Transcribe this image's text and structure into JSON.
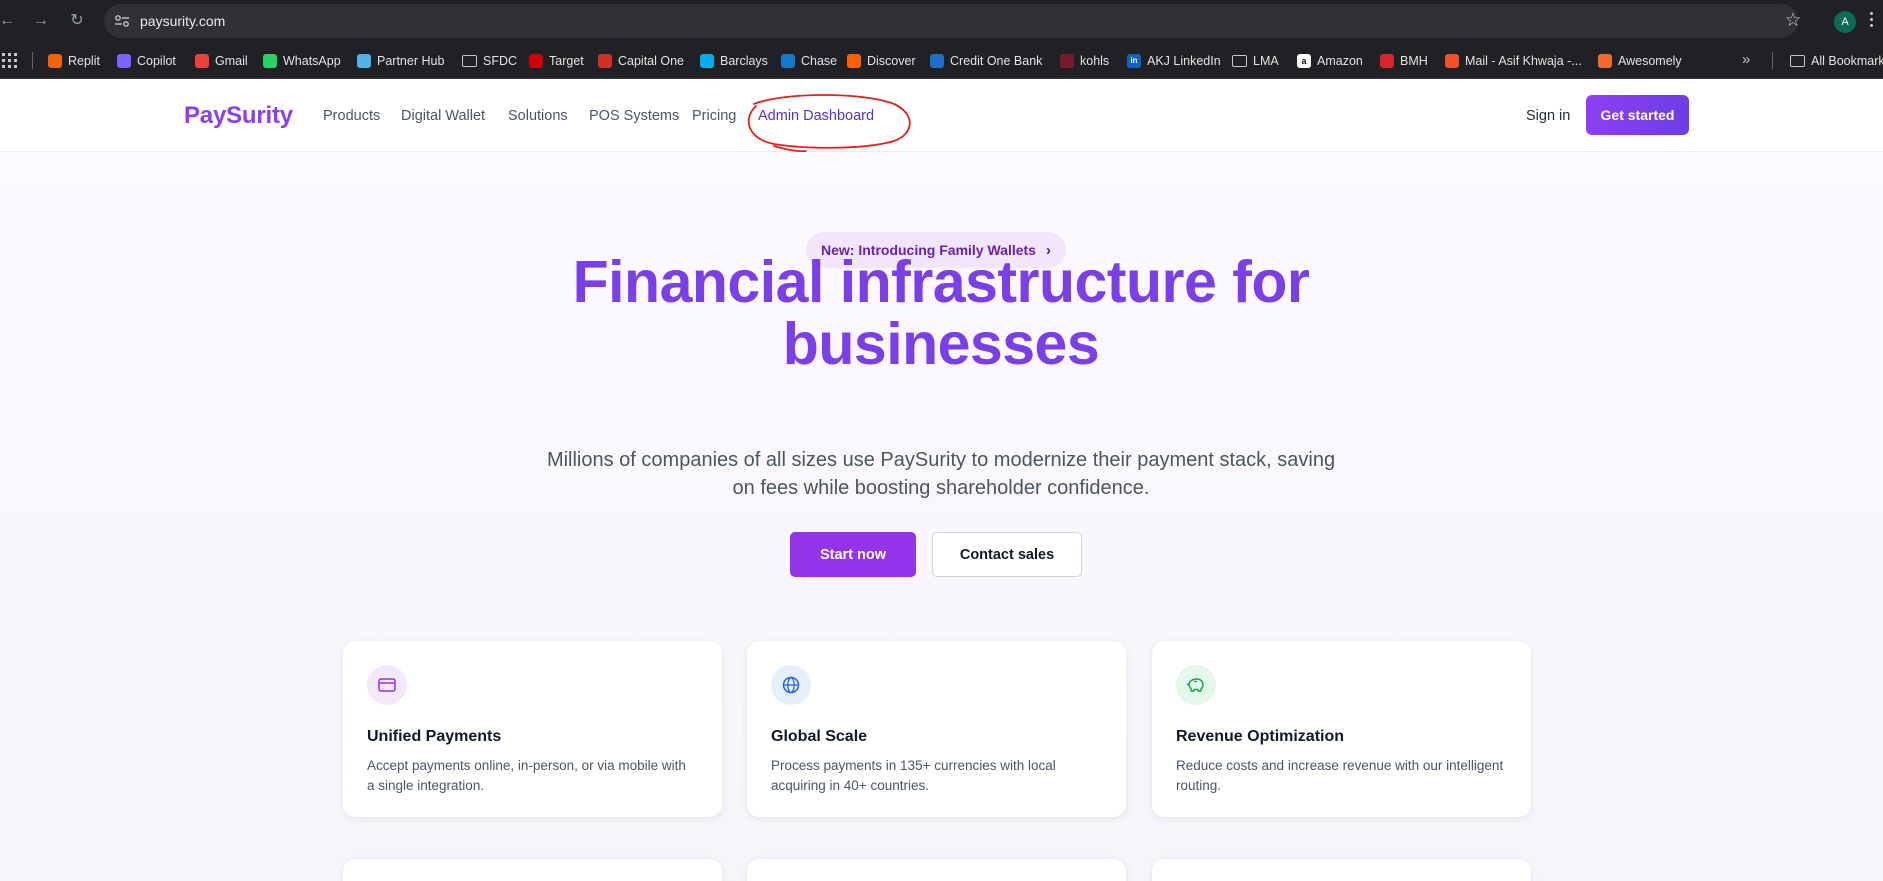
{
  "browser": {
    "url": "paysurity.com",
    "profile_initial": "A",
    "bookmarks": [
      {
        "label": "Replit",
        "icon": "replit-icon",
        "color": "#f26207"
      },
      {
        "label": "Copilot",
        "icon": "copilot-icon",
        "color": "#7b61ff"
      },
      {
        "label": "Gmail",
        "icon": "gmail-icon",
        "color": "#ea4335"
      },
      {
        "label": "WhatsApp",
        "icon": "whatsapp-icon",
        "color": "#25d366"
      },
      {
        "label": "Partner Hub",
        "icon": "partner-hub-icon",
        "color": "#4fb3e8"
      },
      {
        "label": "SFDC",
        "icon": "folder-icon",
        "color": "#c4c7c5"
      },
      {
        "label": "Target",
        "icon": "target-icon",
        "color": "#cc0000"
      },
      {
        "label": "Capital One",
        "icon": "capital-one-icon",
        "color": "#d03027"
      },
      {
        "label": "Barclays",
        "icon": "barclays-icon",
        "color": "#00aeef"
      },
      {
        "label": "Chase",
        "icon": "chase-icon",
        "color": "#117aca"
      },
      {
        "label": "Discover",
        "icon": "discover-icon",
        "color": "#ff6000"
      },
      {
        "label": "Credit One Bank",
        "icon": "credit-one-icon",
        "color": "#1a6fc9"
      },
      {
        "label": "kohls",
        "icon": "kohls-icon",
        "color": "#7a1a2c"
      },
      {
        "label": "AKJ LinkedIn",
        "icon": "linkedin-icon",
        "color": "#0a66c2"
      },
      {
        "label": "LMA",
        "icon": "folder-icon",
        "color": "#c4c7c5"
      },
      {
        "label": "Amazon",
        "icon": "amazon-icon",
        "color": "#ffffff"
      },
      {
        "label": "BMH",
        "icon": "bmh-icon",
        "color": "#d6262b"
      },
      {
        "label": "Mail - Asif Khwaja -...",
        "icon": "microsoft-icon",
        "color": "#f25022"
      },
      {
        "label": "Awesomely",
        "icon": "awesomely-icon",
        "color": "#f26a2e"
      }
    ],
    "all_bookmarks_label": "All Bookmarks"
  },
  "site": {
    "logo": "PaySurity",
    "nav": [
      "Products",
      "Digital Wallet",
      "Solutions",
      "POS Systems",
      "Pricing",
      "Admin Dashboard"
    ],
    "active_nav": "Admin Dashboard",
    "sign_in": "Sign in",
    "get_started": "Get started",
    "colors": {
      "brand": "#8b3ff0",
      "primary_button": "#9333ea",
      "annotation": "#e02020"
    }
  },
  "hero": {
    "pill": "New: Introducing Family Wallets",
    "title_line1": "Financial infrastructure for",
    "title_line2": "businesses",
    "subtitle": "Millions of companies of all sizes use PaySurity to modernize their payment stack, saving on fees while boosting shareholder confidence.",
    "start_now": "Start now",
    "contact_sales": "Contact sales"
  },
  "features": [
    {
      "title": "Unified Payments",
      "desc": "Accept payments online, in-person, or via mobile with a single integration.",
      "icon": "credit-card-icon"
    },
    {
      "title": "Global Scale",
      "desc": "Process payments in 135+ currencies with local acquiring in 40+ countries.",
      "icon": "globe-icon"
    },
    {
      "title": "Revenue Optimization",
      "desc": "Reduce costs and increase revenue with our intelligent routing.",
      "icon": "piggy-bank-icon"
    }
  ]
}
